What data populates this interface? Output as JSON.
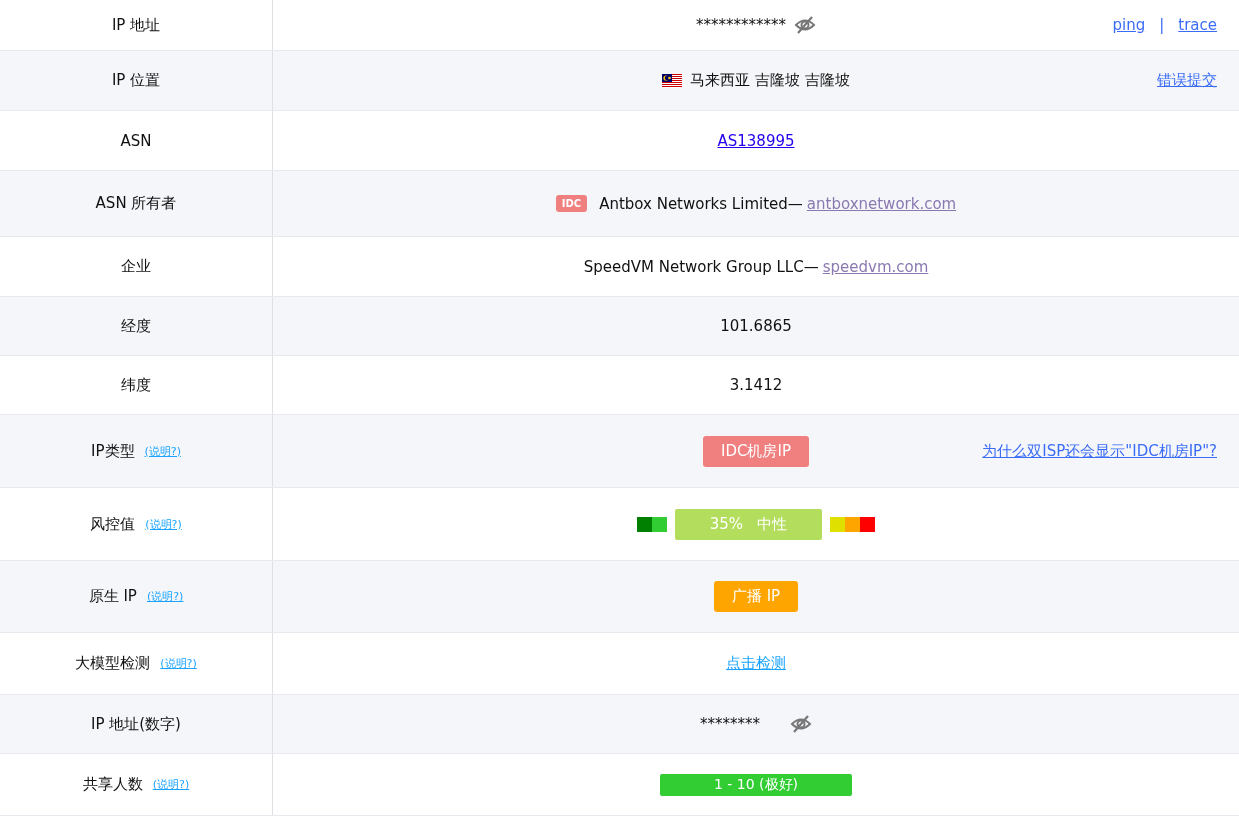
{
  "rows": [
    {
      "label": "IP 地址",
      "kind": "masked",
      "value": "************",
      "links": [
        "ping",
        "trace"
      ],
      "separator": "|"
    },
    {
      "label": "IP 位置",
      "kind": "location",
      "value": "马来西亚 吉隆坡 吉隆坡",
      "side_link": "错误提交"
    },
    {
      "label": "ASN",
      "kind": "link",
      "value": "AS138995"
    },
    {
      "label": "ASN 所有者",
      "kind": "owner",
      "badge": "IDC",
      "value": "Antbox Networks Limited—",
      "link": "antboxnetwork.com"
    },
    {
      "label": "企业",
      "kind": "owner",
      "value": "SpeedVM Network Group LLC—",
      "link": "speedvm.com"
    },
    {
      "label": "经度",
      "kind": "text",
      "value": "101.6865"
    },
    {
      "label": "纬度",
      "kind": "text",
      "value": "3.1412"
    },
    {
      "label": "IP类型",
      "help": "(说明?)",
      "kind": "badge",
      "value": "IDC机房IP",
      "color": "#f08080",
      "side_link": "为什么双ISP还会显示\"IDC机房IP\"?"
    },
    {
      "label": "风控值",
      "help": "(说明?)",
      "kind": "risk",
      "value": "35%   中性",
      "color": "#b3dd5c",
      "left_scale": [
        {
          "color": "#008000"
        },
        {
          "color": "#32cd32"
        }
      ],
      "right_scale": [
        {
          "color": "#e0e000"
        },
        {
          "color": "#ffa500"
        },
        {
          "color": "#ff0000"
        }
      ]
    },
    {
      "label": "原生 IP",
      "help": "(说明?)",
      "kind": "badge",
      "value": "广播 IP",
      "color": "#ffa500"
    },
    {
      "label": "大模型检测",
      "help": "(说明?)",
      "kind": "action",
      "value": "点击检测"
    },
    {
      "label": "IP 地址(数字)",
      "kind": "masked",
      "value": "********"
    },
    {
      "label": "共享人数",
      "help": "(说明?)",
      "kind": "bar",
      "value": "1 - 10 (极好)",
      "color": "#32cd32"
    }
  ]
}
